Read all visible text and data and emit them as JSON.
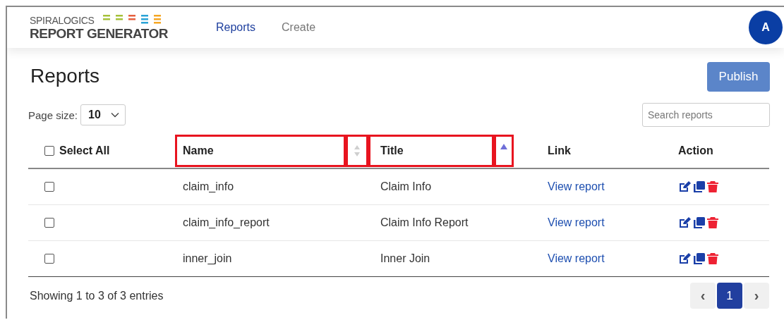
{
  "header": {
    "logo_top": "SPIRALOGICS",
    "logo_bottom": "REPORT GENERATOR",
    "nav": [
      {
        "label": "Reports",
        "selected": true
      },
      {
        "label": "Create",
        "selected": false
      }
    ],
    "avatar": "A"
  },
  "page": {
    "title": "Reports",
    "publish_button": "Publish",
    "page_size_label": "Page size:",
    "page_size": "10",
    "search": {
      "placeholder": "Search reports"
    }
  },
  "table": {
    "select_all": {
      "label": "Select All",
      "checked": false
    },
    "columns": [
      {
        "label": "Name",
        "sortable": true,
        "sorted": false,
        "highlighted": true
      },
      {
        "label": "Title",
        "sortable": true,
        "sorted": true,
        "highlighted": true
      },
      {
        "label": "Link",
        "sortable": false,
        "highlighted": false
      },
      {
        "label": "Action",
        "sortable": false,
        "highlighted": false
      }
    ],
    "rows": [
      {
        "checked": false,
        "name": "claim_info",
        "title": "Claim Info",
        "link": "View report"
      },
      {
        "checked": false,
        "name": "claim_info_report",
        "title": "Claim Info Report",
        "link": "View report"
      },
      {
        "checked": false,
        "name": "inner_join",
        "title": "Inner Join",
        "link": "View report"
      }
    ]
  },
  "footer": {
    "summary": "Showing 1 to 3 of 3 entries",
    "prev": "‹",
    "next": "›",
    "pages": [
      {
        "label": "1",
        "selected": true
      }
    ]
  }
}
